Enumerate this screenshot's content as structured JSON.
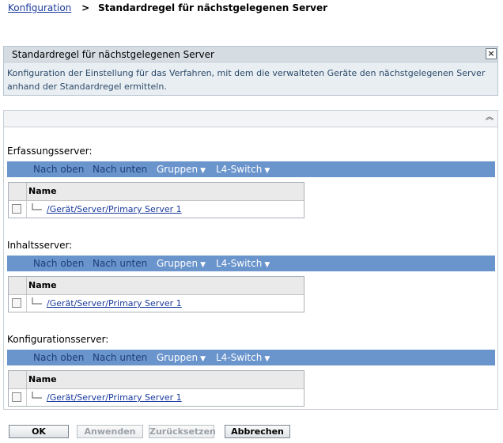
{
  "breadcrumb": {
    "root": "Konfiguration",
    "separator": ">",
    "current": "Standardregel für nächstgelegenen Server"
  },
  "info_panel": {
    "title": "Standardregel für nächstgelegenen Server",
    "description": "Konfiguration der Einstellung für das Verfahren, mit dem die verwalteten Geräte den nächstgelegenen Server anhand der Standardregel ermitteln.",
    "close_glyph": "×"
  },
  "main_panel": {
    "collapse_glyph": "︽"
  },
  "toolbar": {
    "move_up": "Nach oben",
    "move_down": "Nach unten",
    "groups": "Gruppen",
    "l4switch": "L4-Switch",
    "caret": "▼"
  },
  "sections": [
    {
      "label": "Erfassungsserver:",
      "column_header": "Name",
      "rows": [
        {
          "name": "/Gerät/Server/Primary Server 1"
        }
      ]
    },
    {
      "label": "Inhaltsserver:",
      "column_header": "Name",
      "rows": [
        {
          "name": "/Gerät/Server/Primary Server 1"
        }
      ]
    },
    {
      "label": "Konfigurationsserver:",
      "column_header": "Name",
      "rows": [
        {
          "name": "/Gerät/Server/Primary Server 1"
        }
      ]
    }
  ],
  "buttons": {
    "ok": "OK",
    "apply": "Anwenden",
    "reset": "Zurücksetzen",
    "cancel": "Abbrechen"
  },
  "colors": {
    "toolbar_bg": "#6a94cc",
    "link": "#1a3a9c",
    "panel_bg": "#e9eef2"
  }
}
